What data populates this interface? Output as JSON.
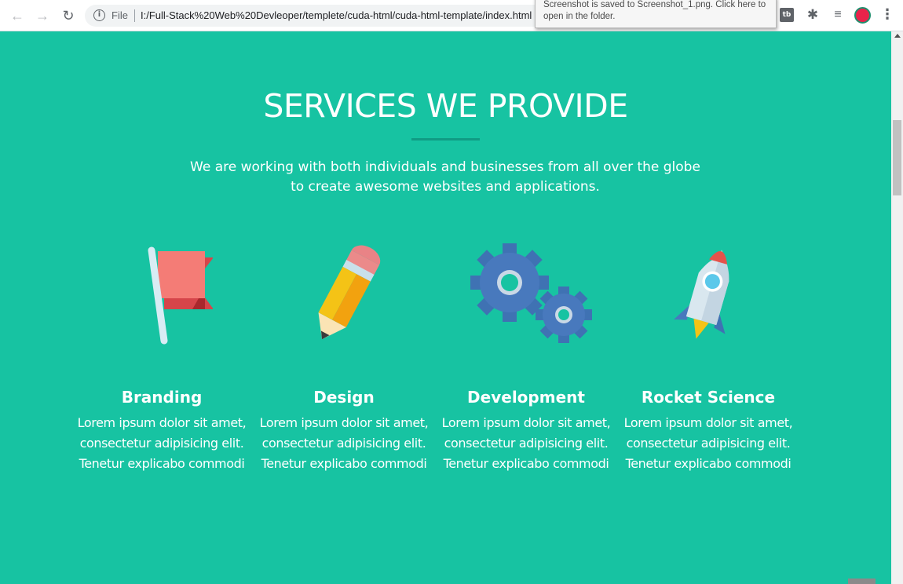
{
  "browser": {
    "back_glyph": "←",
    "forward_glyph": "→",
    "reload_glyph": "↻",
    "info_glyph": "i",
    "scheme_label": "File",
    "url": "I:/Full-Stack%20Web%20Devleoper/templete/cuda-html/cuda-html-template/index.html",
    "star_glyph": "☆",
    "extension_g_label": "G",
    "extension_tb_label": "tb",
    "puzzle_glyph": "✱",
    "media_glyph": "≡",
    "menu_glyph": "⋮",
    "tooltip_text": "Screenshot is saved to Screenshot_1.png. Click here to open in the folder."
  },
  "icons": {
    "back": "arrow-left-icon",
    "forward": "arrow-right-icon",
    "reload": "reload-icon",
    "info": "info-icon",
    "bookmark": "star-icon",
    "extension_cube": "cube-icon",
    "extension_grammarly": "grammarly-icon",
    "extension_tb": "tb-icon",
    "extensions": "puzzle-icon",
    "media": "media-control-icon",
    "menu": "kebab-menu-icon"
  },
  "colors": {
    "page_background": "#17c3a2",
    "underline": "#109c84",
    "text": "#ffffff"
  },
  "section": {
    "title": "SERVICES WE PROVIDE",
    "subtitle_line1": "We are working with both individuals and businesses from all over the globe",
    "subtitle_line2": "to create awesome websites and applications."
  },
  "services": [
    {
      "title": "Branding",
      "icon": "flag-icon",
      "line1": "Lorem ipsum dolor sit amet,",
      "line2": "consectetur adipisicing elit.",
      "line3": "Tenetur explicabo commodi"
    },
    {
      "title": "Design",
      "icon": "pencil-icon",
      "line1": "Lorem ipsum dolor sit amet,",
      "line2": "consectetur adipisicing elit.",
      "line3": "Tenetur explicabo commodi"
    },
    {
      "title": "Development",
      "icon": "gears-icon",
      "line1": "Lorem ipsum dolor sit amet,",
      "line2": "consectetur adipisicing elit.",
      "line3": "Tenetur explicabo commodi"
    },
    {
      "title": "Rocket Science",
      "icon": "rocket-icon",
      "line1": "Lorem ipsum dolor sit amet,",
      "line2": "consectetur adipisicing elit.",
      "line3": "Tenetur explicabo commodi"
    }
  ]
}
